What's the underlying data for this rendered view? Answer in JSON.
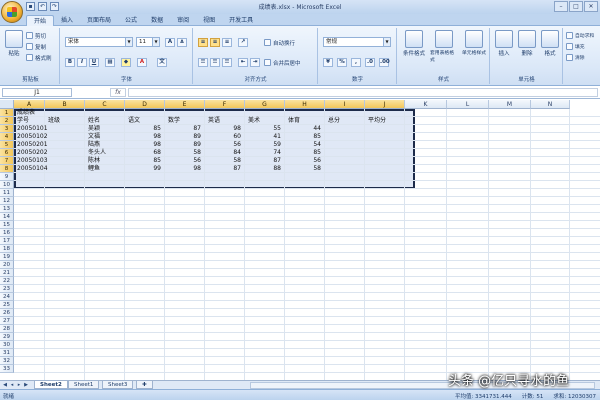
{
  "window": {
    "title": "成绩表.xlsx - Microsoft Excel"
  },
  "tabs": [
    "开始",
    "插入",
    "页面布局",
    "公式",
    "数据",
    "审阅",
    "视图",
    "开发工具"
  ],
  "active_tab": 0,
  "ribbon": {
    "clipboard": {
      "label": "剪贴板",
      "paste": "粘贴",
      "cut": "剪切",
      "copy": "复制",
      "format_painter": "格式刷"
    },
    "font": {
      "label": "字体",
      "name": "宋体",
      "size": "11",
      "grow": "A",
      "shrink": "A",
      "bold": "B",
      "italic": "I",
      "underline": "U",
      "color": "A"
    },
    "alignment": {
      "label": "对齐方式",
      "wrap": "自动换行",
      "merge": "合并后居中"
    },
    "number": {
      "label": "数字",
      "format": "常规",
      "percent": "%"
    },
    "styles": {
      "label": "样式",
      "conditional": "条件格式",
      "table_format": "套用表格格式",
      "cell_style": "单元格样式"
    },
    "cells": {
      "label": "单元格",
      "insert": "插入",
      "delete": "删除",
      "format": "格式"
    },
    "editing": {
      "autosum": "自动求和",
      "fill": "填充",
      "clear": "清除"
    }
  },
  "formula_bar": {
    "name_box": "J1",
    "fx": "fx",
    "value": ""
  },
  "columns": [
    "A",
    "B",
    "C",
    "D",
    "E",
    "F",
    "G",
    "H",
    "I",
    "J",
    "K",
    "L",
    "M",
    "N"
  ],
  "selected_columns": [
    "A",
    "B",
    "C",
    "D",
    "E",
    "F",
    "G",
    "H",
    "I",
    "J"
  ],
  "rows": [
    "1",
    "2",
    "3",
    "4",
    "5",
    "6",
    "7",
    "8",
    "9",
    "10",
    "11",
    "12",
    "13",
    "14",
    "15",
    "16",
    "17",
    "18",
    "19",
    "20",
    "21",
    "22",
    "23",
    "24",
    "25",
    "26",
    "27",
    "28",
    "29",
    "30",
    "31",
    "32",
    "33"
  ],
  "selected_rows": [
    "1",
    "2",
    "3",
    "4",
    "5",
    "6",
    "7",
    "8"
  ],
  "sheet": {
    "title_cell": "成绩表",
    "headers": [
      "学号",
      "班级",
      "姓名",
      "语文",
      "数学",
      "英语",
      "美术",
      "体育",
      "总分",
      "平均分"
    ],
    "records": [
      [
        "20050101",
        "",
        "吴颖",
        "85",
        "87",
        "98",
        "55",
        "44",
        "",
        ""
      ],
      [
        "20050102",
        "",
        "文福",
        "98",
        "89",
        "60",
        "41",
        "85",
        "",
        ""
      ],
      [
        "20050201",
        "",
        "陆燕",
        "98",
        "89",
        "56",
        "59",
        "54",
        "",
        ""
      ],
      [
        "20050202",
        "",
        "冬头人",
        "68",
        "58",
        "84",
        "74",
        "85",
        "",
        ""
      ],
      [
        "20050103",
        "",
        "陈林",
        "85",
        "56",
        "58",
        "87",
        "56",
        "",
        ""
      ],
      [
        "20050104",
        "",
        "鲤鱼",
        "99",
        "98",
        "87",
        "88",
        "58",
        "",
        ""
      ]
    ]
  },
  "sheet_tabs": [
    "Sheet2",
    "Sheet1",
    "Sheet3"
  ],
  "active_sheet": 0,
  "status": {
    "ready": "就绪",
    "average": "平均值: 3341731.444",
    "count": "计数: 51",
    "sum": "求和: 12030307"
  },
  "watermark": "头条 @亿只寻水的鱼",
  "colors": {
    "accent": "#bfd5ef",
    "selection_border": "#1d2b4a"
  }
}
